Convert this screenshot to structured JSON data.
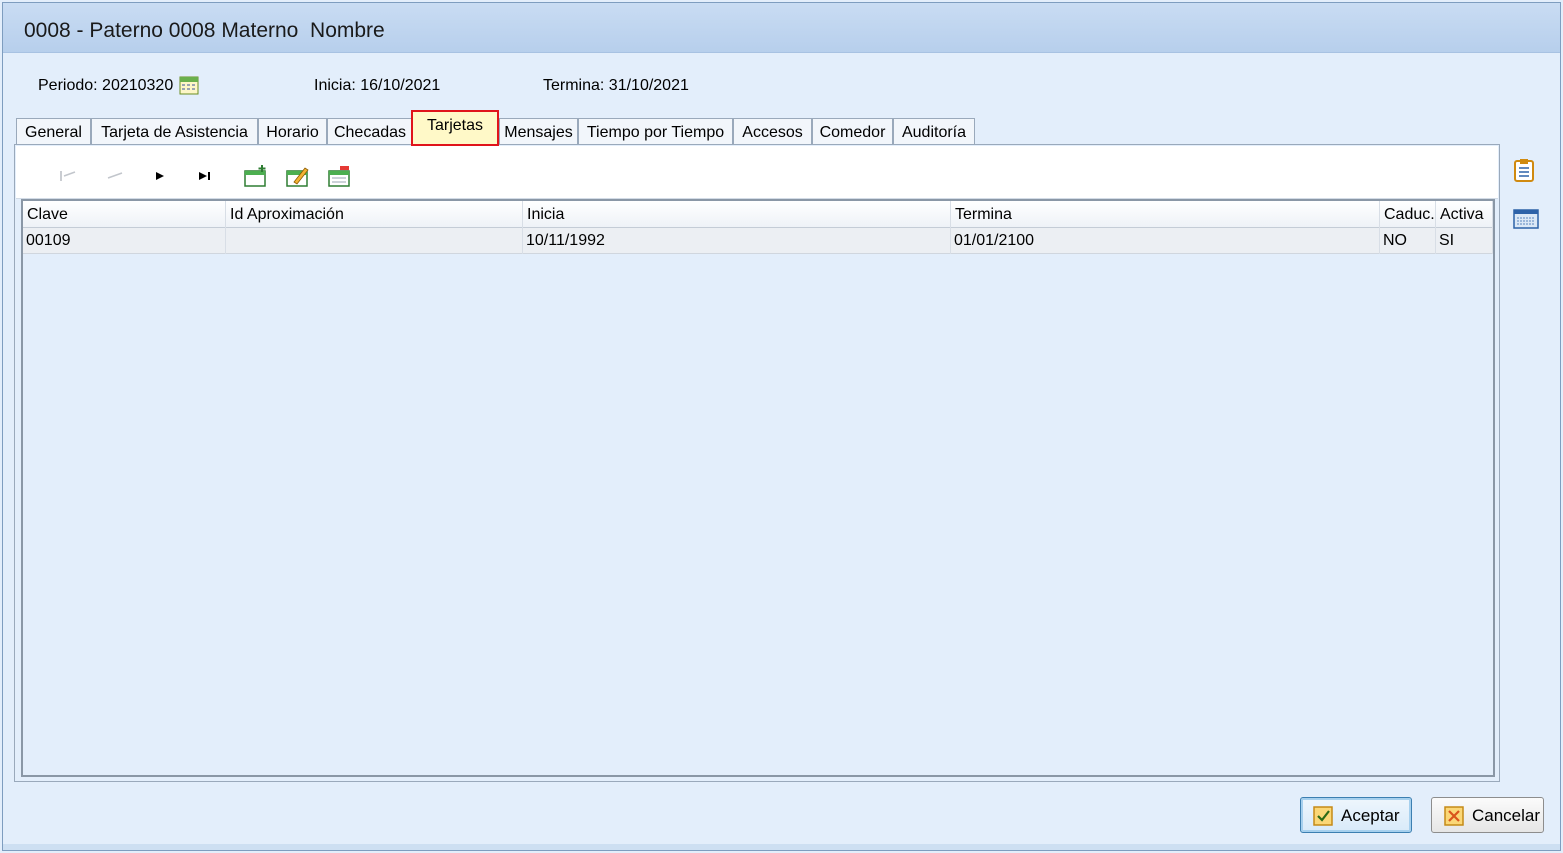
{
  "window": {
    "title": "0008 - Paterno 0008 Materno  Nombre"
  },
  "period": {
    "periodo": "Periodo: 20210320",
    "inicia": "Inicia: 16/10/2021",
    "termina": "Termina: 31/10/2021"
  },
  "tabs": [
    {
      "label": "General"
    },
    {
      "label": "Tarjeta de Asistencia"
    },
    {
      "label": "Horario"
    },
    {
      "label": "Checadas"
    },
    {
      "label": "Tarjetas",
      "active": true
    },
    {
      "label": "Mensajes"
    },
    {
      "label": "Tiempo por Tiempo"
    },
    {
      "label": "Accesos"
    },
    {
      "label": "Comedor"
    },
    {
      "label": "Auditoría"
    }
  ],
  "toolbar": {
    "icons": [
      "first-record-icon",
      "previous-record-icon",
      "next-record-icon",
      "last-record-icon",
      "add-record-icon",
      "edit-record-icon",
      "delete-record-icon"
    ]
  },
  "grid": {
    "columns": [
      "Clave",
      "Id Aproximación",
      "Inicia",
      "Termina",
      "Caduc.",
      "Activa"
    ],
    "rows": [
      {
        "clave": "00109",
        "id_aproximacion": "",
        "inicia": "10/11/1992",
        "termina": "01/01/2100",
        "caduca": "NO",
        "activa": "SI"
      }
    ]
  },
  "side_icons": [
    "clipboard-icon",
    "keyboard-icon"
  ],
  "buttons": {
    "accept": "Aceptar",
    "cancel": "Cancelar"
  },
  "colors": {
    "active_tab_highlight": "#e0141b",
    "active_tab_bg": "#fff9c8",
    "window_bg": "#e3eefb"
  }
}
